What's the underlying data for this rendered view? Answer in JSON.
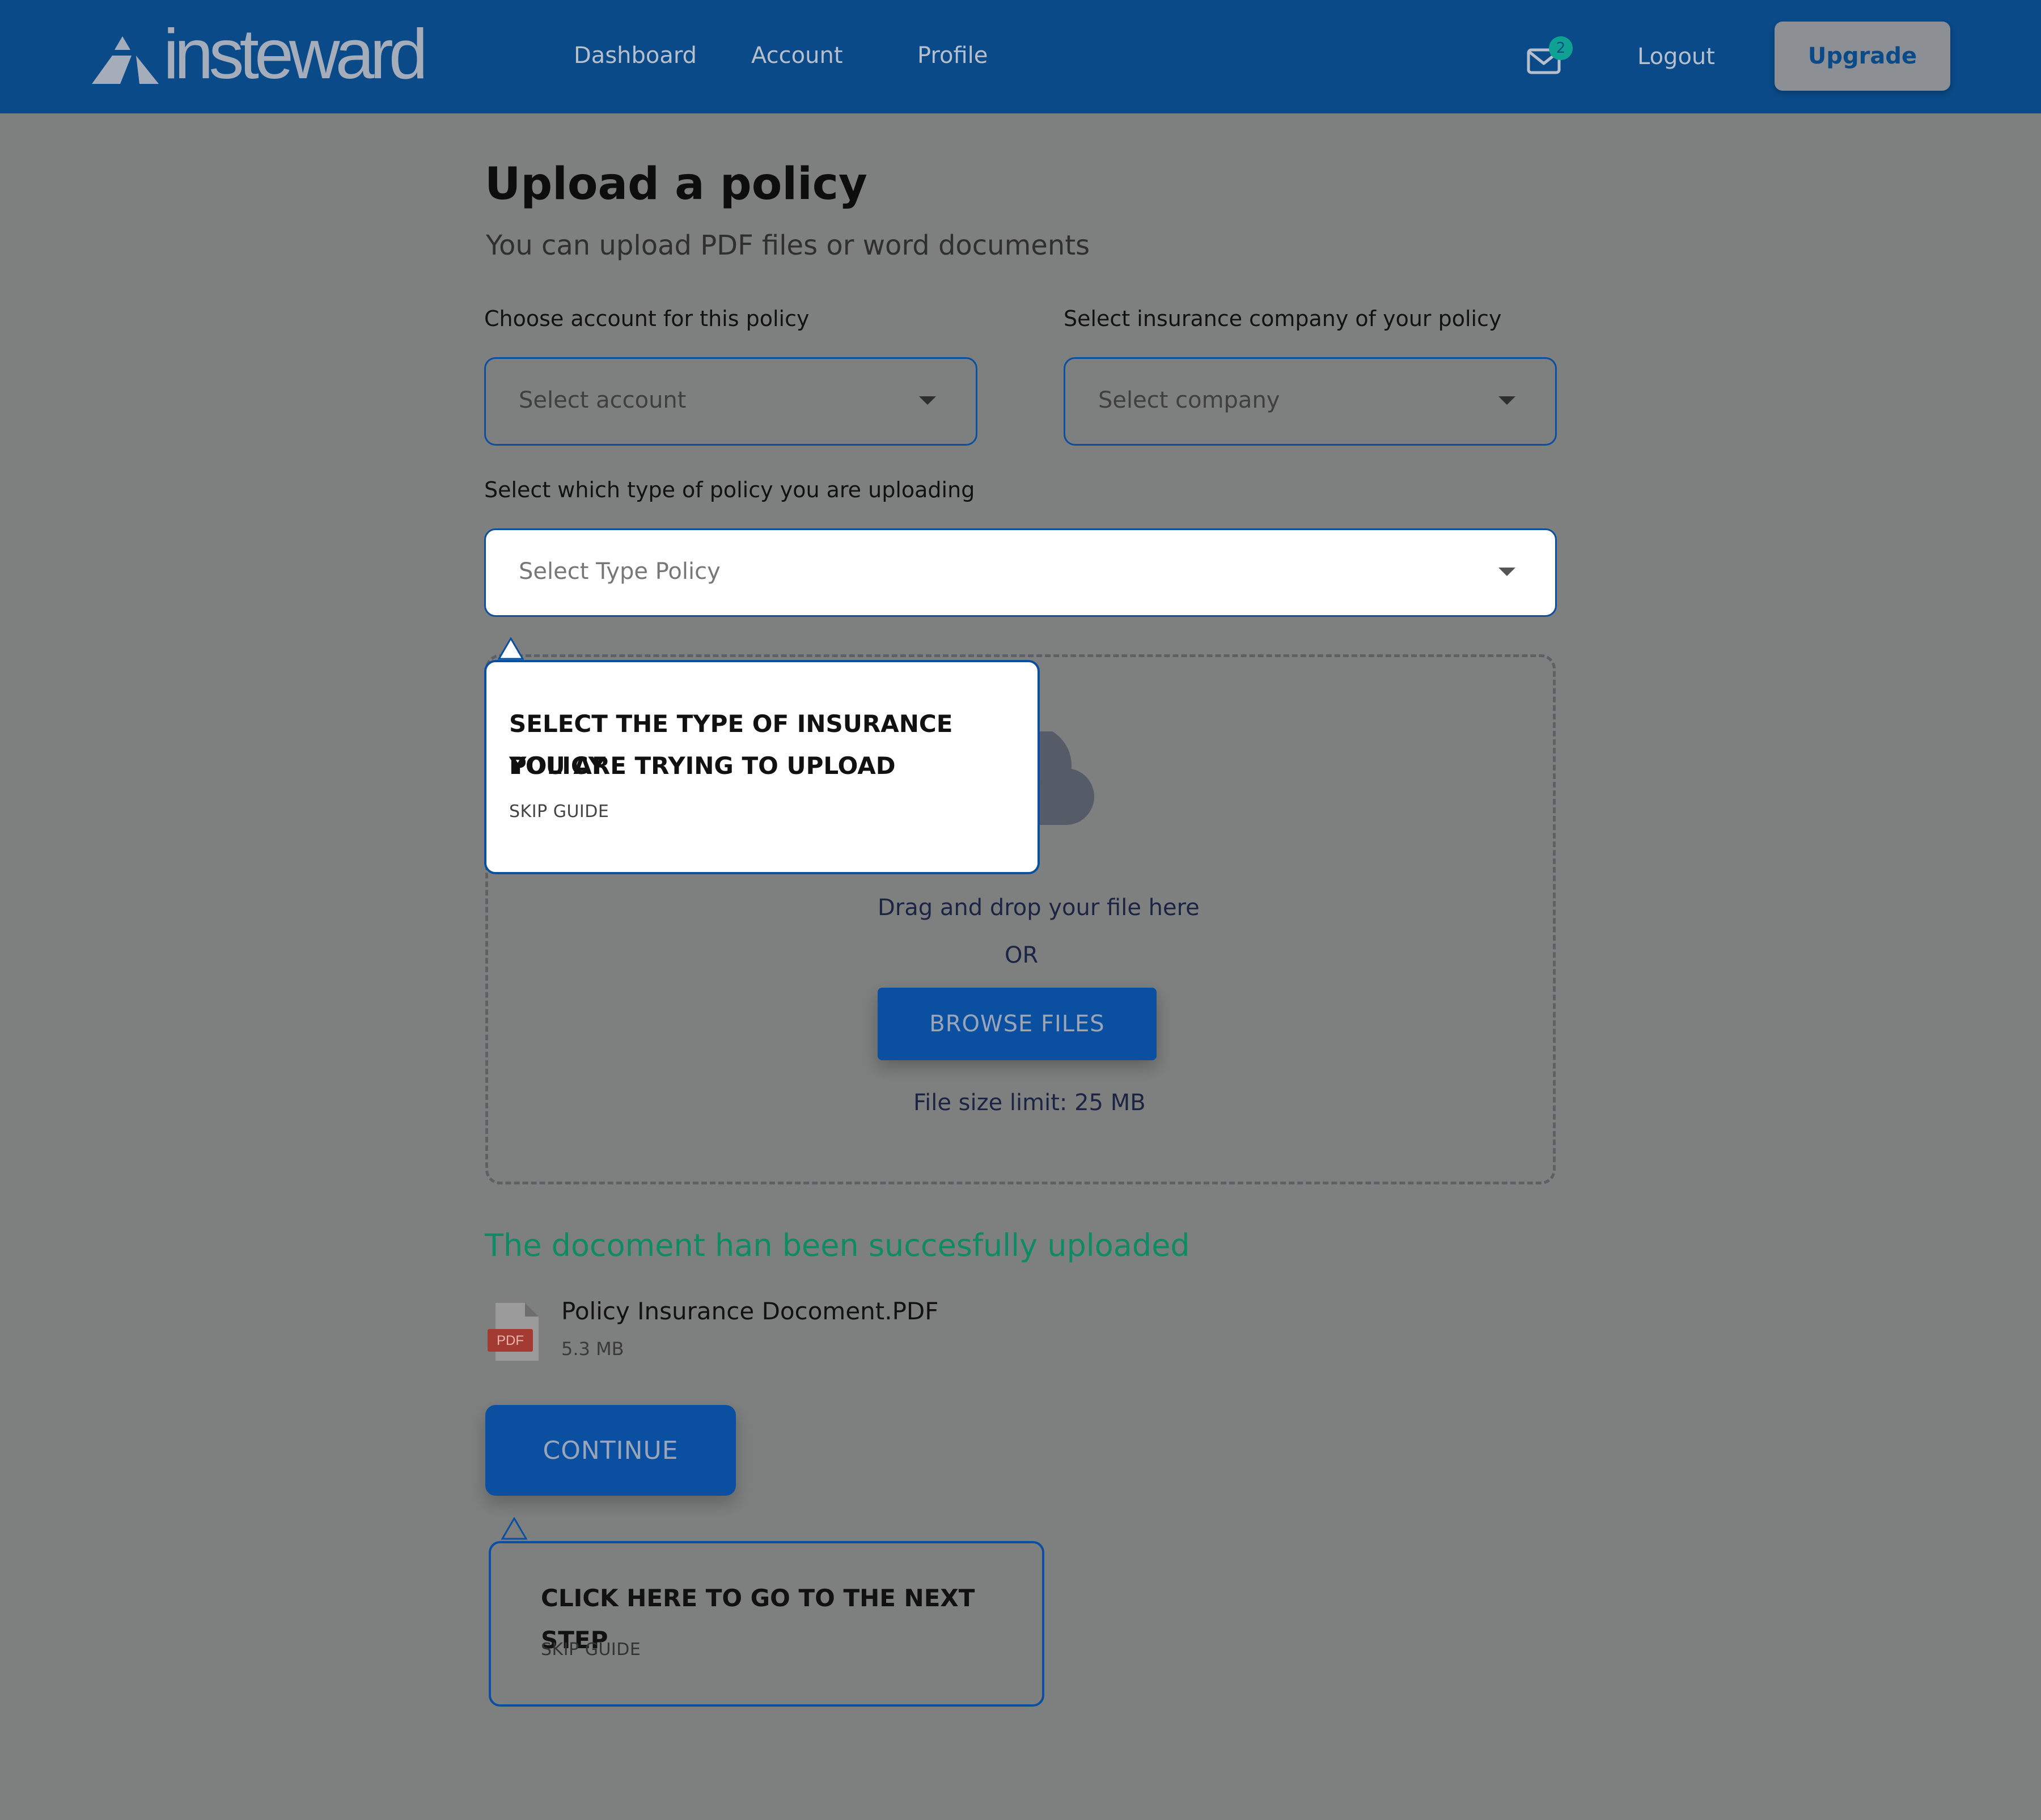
{
  "header": {
    "logo_text": "insteward",
    "nav": [
      "Dashboard",
      "Account",
      "Profile"
    ],
    "mail_count": "2",
    "logout_label": "Logout",
    "upgrade_label": "Upgrade"
  },
  "page": {
    "title": "Upload a policy",
    "subtitle": "You can upload PDF files or word documents"
  },
  "form": {
    "account_label": "Choose account for this policy",
    "account_placeholder": "Select account",
    "company_label": "Select insurance company of your policy",
    "company_placeholder": "Select company",
    "type_label": "Select which type of policy you are uploading",
    "type_placeholder": "Select Type Policy"
  },
  "dropzone": {
    "drag_text": "Drag and drop your file here",
    "or_text": "OR",
    "browse_label": "BROWSE FILES",
    "limit_text": "File size limit: 25 MB"
  },
  "upload": {
    "success_text": "The docoment han been succesfully uploaded",
    "file_name": "Policy Insurance Docoment.PDF",
    "file_size": "5.3 MB",
    "file_badge": "PDF"
  },
  "continue_label": "CONTINUE",
  "guides": {
    "type_tip": {
      "line1": "SELECT THE TYPE OF INSURANCE POLICY",
      "line2": "YOU ARE TRYING TO UPLOAD",
      "skip": "SKIP GUIDE"
    },
    "continue_tip": {
      "line1": "CLICK HERE TO GO TO THE NEXT STEP",
      "skip": "SKIP GUIDE"
    }
  },
  "colors": {
    "header_bg": "#0a4a88",
    "overlay_bg": "#7e7f7f",
    "primary": "#0b4fa0",
    "success": "#0f8b63",
    "badge": "#0fa293"
  }
}
